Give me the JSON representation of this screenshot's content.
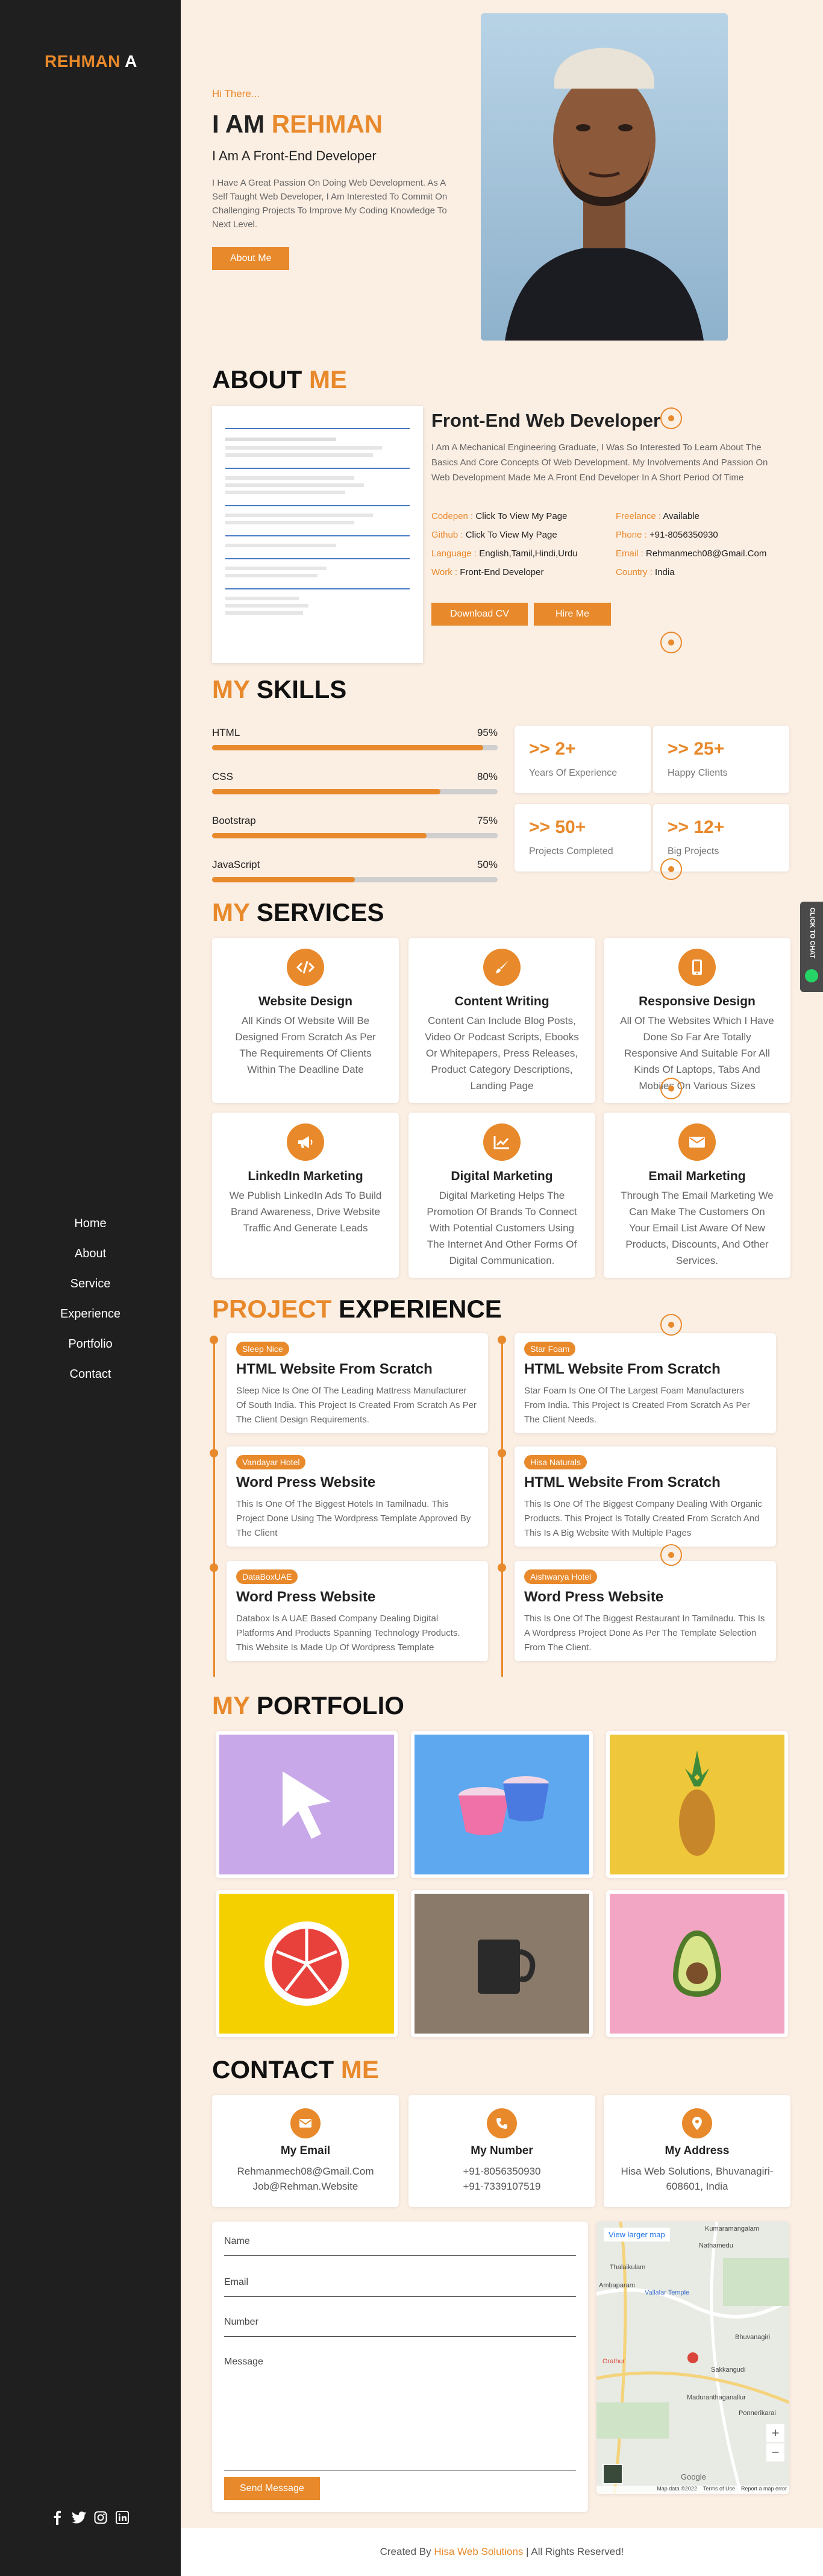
{
  "brand": {
    "name": "REHMAN",
    "suffix": "A",
    "accent": "#e8892b",
    "sidebar_bg": "#1f1f1f",
    "page_bg": "#fbeee3"
  },
  "nav": [
    "Home",
    "About",
    "Service",
    "Experience",
    "Portfolio",
    "Contact"
  ],
  "social": [
    "facebook-icon",
    "twitter-icon",
    "instagram-icon",
    "linkedin-icon"
  ],
  "hero": {
    "greeting": "Hi There...",
    "title_prefix": "I AM",
    "title_name": "REHMAN",
    "subtitle": "I Am A Front-End Developer",
    "description": "I Have A Great Passion On Doing Web Development. As A Self Taught Web Developer, I Am Interested To Commit On Challenging Projects To Improve My Coding Knowledge To Next Level.",
    "button": "About Me"
  },
  "about": {
    "title_a": "ABOUT",
    "title_b": "ME",
    "heading": "Front-End Web Developer",
    "text": "I Am A Mechanical Engineering Graduate, I Was So Interested To Learn About The Basics And Core Concepts Of Web Development. My Involvements And Passion On Web Development Made Me A Front End Developer In A Short Period Of Time",
    "info": [
      {
        "label": "Codepen :",
        "value": "Click To View My Page"
      },
      {
        "label": "Freelance :",
        "value": "Available"
      },
      {
        "label": "Github :",
        "value": "Click To View My Page"
      },
      {
        "label": "Phone :",
        "value": "+91-8056350930"
      },
      {
        "label": "Language :",
        "value": "English,Tamil,Hindi,Urdu"
      },
      {
        "label": "Email :",
        "value": "Rehmanmech08@Gmail.Com"
      },
      {
        "label": "Work :",
        "value": "Front-End Developer"
      },
      {
        "label": "Country :",
        "value": "India"
      }
    ],
    "btn_cv": "Download CV",
    "btn_hire": "Hire Me"
  },
  "skills": {
    "title_a": "MY",
    "title_b": "SKILLS",
    "items": [
      {
        "name": "HTML",
        "pct": "95%",
        "value": 95
      },
      {
        "name": "CSS",
        "pct": "80%",
        "value": 80
      },
      {
        "name": "Bootstrap",
        "pct": "75%",
        "value": 75
      },
      {
        "name": "JavaScript",
        "pct": "50%",
        "value": 50
      }
    ],
    "stats": [
      {
        "num": ">> 2+",
        "label": "Years Of Experience"
      },
      {
        "num": ">> 25+",
        "label": "Happy Clients"
      },
      {
        "num": ">> 50+",
        "label": "Projects Completed"
      },
      {
        "num": ">> 12+",
        "label": "Big Projects"
      }
    ]
  },
  "services": {
    "title_a": "MY",
    "title_b": "SERVICES",
    "items": [
      {
        "icon": "code-icon",
        "title": "Website Design",
        "desc": "All Kinds Of Website Will Be Designed From Scratch As Per The Requirements Of Clients Within The Deadline Date"
      },
      {
        "icon": "brush-icon",
        "title": "Content Writing",
        "desc": "Content Can Include Blog Posts, Video Or Podcast Scripts, Ebooks Or Whitepapers, Press Releases, Product Category Descriptions, Landing Page"
      },
      {
        "icon": "mobile-icon",
        "title": "Responsive Design",
        "desc": "All Of The Websites Which I Have Done So Far Are Totally Responsive And Suitable For All Kinds Of Laptops, Tabs And Mobiles On Various Sizes"
      },
      {
        "icon": "megaphone-icon",
        "title": "LinkedIn Marketing",
        "desc": "We Publish LinkedIn Ads To Build Brand Awareness, Drive Website Traffic And Generate Leads"
      },
      {
        "icon": "chart-icon",
        "title": "Digital Marketing",
        "desc": "Digital Marketing Helps The Promotion Of Brands To Connect With Potential Customers Using The Internet And Other Forms Of Digital Communication."
      },
      {
        "icon": "envelope-icon",
        "title": "Email Marketing",
        "desc": "Through The Email Marketing We Can Make The Customers On Your Email List Aware Of New Products, Discounts, And Other Services."
      }
    ]
  },
  "experience": {
    "title_a": "PROJECT",
    "title_b": "EXPERIENCE",
    "items": [
      {
        "badge": "Sleep Nice",
        "title": "HTML Website From Scratch",
        "desc": "Sleep Nice Is One Of The Leading Mattress Manufacturer Of South India. This Project Is Created From Scratch As Per The Client Design Requirements."
      },
      {
        "badge": "Star Foam",
        "title": "HTML Website From Scratch",
        "desc": "Star Foam Is One Of The Largest Foam Manufacturers From India. This Project Is Created From Scratch As Per The Client Needs."
      },
      {
        "badge": "Vandayar Hotel",
        "title": "Word Press Website",
        "desc": "This Is One Of The Biggest Hotels In Tamilnadu. This Project Done Using The Wordpress Template Approved By The Client"
      },
      {
        "badge": "Hisa Naturals",
        "title": "HTML Website From Scratch",
        "desc": "This Is One Of The Biggest Company Dealing With Organic Products. This Project Is Totally Created From Scratch And This Is A Big Website With Multiple Pages"
      },
      {
        "badge": "DataBoxUAE",
        "title": "Word Press Website",
        "desc": "Databox Is A UAE Based Company Dealing Digital Platforms And Products Spanning Technology Products. This Website Is Made Up Of Wordpress Template"
      },
      {
        "badge": "Aishwarya Hotel",
        "title": "Word Press Website",
        "desc": "This Is One Of The Biggest Restaurant In Tamilnadu. This Is A Wordpress Project Done As Per The Template Selection From The Client."
      }
    ]
  },
  "portfolio": {
    "title_a": "MY",
    "title_b": "PORTFOLIO",
    "items": [
      {
        "name": "cursor",
        "bg": "#c8a8e8"
      },
      {
        "name": "ice-cream",
        "bg": "#5ea8f0"
      },
      {
        "name": "pineapple",
        "bg": "#eec83a"
      },
      {
        "name": "watermelon",
        "bg": "#f5d000"
      },
      {
        "name": "mug",
        "bg": "#8a7a6a"
      },
      {
        "name": "avocado",
        "bg": "#f3a6c4"
      }
    ]
  },
  "contact": {
    "title_a": "CONTACT",
    "title_b": "ME",
    "cards": [
      {
        "icon": "envelope-icon",
        "title": "My Email",
        "lines": [
          "Rehmanmech08@Gmail.Com",
          "Job@Rehman.Website"
        ]
      },
      {
        "icon": "phone-icon",
        "title": "My Number",
        "lines": [
          "+91-8056350930",
          "+91-7339107519"
        ]
      },
      {
        "icon": "location-icon",
        "title": "My Address",
        "lines": [
          "Hisa Web Solutions, Bhuvanagiri-",
          "608601, India"
        ]
      }
    ],
    "form": {
      "name": "Name",
      "email": "Email",
      "number": "Number",
      "message": "Message",
      "submit": "Send Message"
    },
    "map": {
      "link": "View larger map",
      "labels": [
        "Kumaramangalam",
        "Nathamedu",
        "Thalaikulam",
        "Ambaparam",
        "Vallalar Temple",
        "Bhuvanagiri",
        "Sakkangudi",
        "Orathur",
        "Maduranthaganallur",
        "Ponnerikarai"
      ],
      "footer": [
        "Map data ©2022",
        "Terms of Use",
        "Report a map error"
      ],
      "google": "Google"
    }
  },
  "footer": {
    "prefix": "Created By",
    "company": "Hisa Web Solutions",
    "suffix": "| All Rights Reserved!"
  },
  "chat": {
    "label": "CLICK TO CHAT"
  }
}
